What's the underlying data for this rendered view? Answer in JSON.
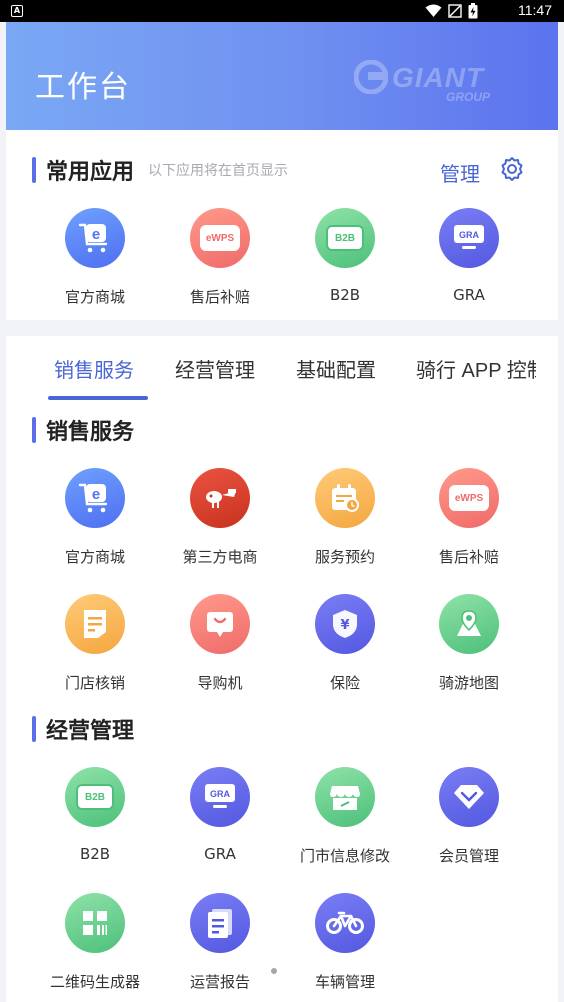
{
  "status_bar": {
    "app_indicator": "A",
    "time": "11:47"
  },
  "header": {
    "title": "工作台",
    "logo_text": "GIANT",
    "logo_sub": "GROUP"
  },
  "common": {
    "title": "常用应用",
    "hint": "以下应用将在首页显示",
    "manage_label": "管理",
    "apps": [
      {
        "label": "官方商城",
        "icon": "cart-e-icon",
        "color": "#5b79f2"
      },
      {
        "label": "售后补赔",
        "icon": "ewps-icon",
        "color": "#f07b72"
      },
      {
        "label": "B2B",
        "icon": "b2b-icon",
        "color": "#5fcc88"
      },
      {
        "label": "GRA",
        "icon": "gra-icon",
        "color": "#5a60e6"
      }
    ]
  },
  "tabs": [
    {
      "label": "销售服务",
      "active": true
    },
    {
      "label": "经营管理",
      "active": false
    },
    {
      "label": "基础配置",
      "active": false
    },
    {
      "label": "骑行 APP 控制",
      "active": false
    }
  ],
  "sales": {
    "title": "销售服务",
    "apps": [
      {
        "label": "官方商城",
        "icon": "cart-e-icon"
      },
      {
        "label": "第三方电商",
        "icon": "third-party-shop-icon"
      },
      {
        "label": "服务预约",
        "icon": "calendar-icon"
      },
      {
        "label": "售后补赔",
        "icon": "ewps-icon"
      },
      {
        "label": "门店核销",
        "icon": "document-icon"
      },
      {
        "label": "导购机",
        "icon": "guide-screen-icon"
      },
      {
        "label": "保险",
        "icon": "shield-yen-icon"
      },
      {
        "label": "骑游地图",
        "icon": "map-pin-icon"
      }
    ]
  },
  "ops": {
    "title": "经营管理",
    "apps": [
      {
        "label": "B2B",
        "icon": "b2b-icon"
      },
      {
        "label": "GRA",
        "icon": "gra-icon"
      },
      {
        "label": "门市信息修改",
        "icon": "storefront-icon"
      },
      {
        "label": "会员管理",
        "icon": "diamond-icon"
      },
      {
        "label": "二维码生成器",
        "icon": "qr-code-icon"
      },
      {
        "label": "运营报告",
        "icon": "report-icon"
      },
      {
        "label": "车辆管理",
        "icon": "bicycle-icon"
      }
    ]
  },
  "icon_text": {
    "ewps": "eWPS",
    "b2b": "B2B",
    "gra": "GRA",
    "e": "e"
  }
}
